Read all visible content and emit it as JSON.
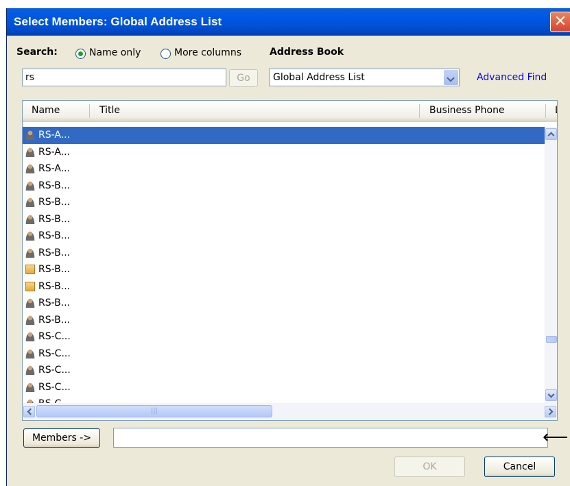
{
  "window": {
    "title": "Select Members: Global Address List",
    "close_glyph": "✕"
  },
  "search": {
    "label": "Search:",
    "options": [
      {
        "label": "Name only",
        "selected": true
      },
      {
        "label": "More columns",
        "selected": false
      }
    ],
    "value": "rs",
    "go_label": "Go"
  },
  "address_book": {
    "label": "Address Book",
    "selected": "Global Address List",
    "advanced_find": "Advanced Find"
  },
  "columns": [
    "Name",
    "Title",
    "Business Phone",
    "L"
  ],
  "rows": [
    {
      "name": "RS-A...",
      "icon": "person-icon",
      "selected": true
    },
    {
      "name": "RS-A...",
      "icon": "person-icon"
    },
    {
      "name": "RS-A...",
      "icon": "person-icon"
    },
    {
      "name": "RS-B...",
      "icon": "person-icon"
    },
    {
      "name": "RS-B...",
      "icon": "person-icon"
    },
    {
      "name": "RS-B...",
      "icon": "person-icon"
    },
    {
      "name": "RS-B...",
      "icon": "person-icon"
    },
    {
      "name": "RS-B...",
      "icon": "person-icon"
    },
    {
      "name": "RS-B...",
      "icon": "distribution-list-icon"
    },
    {
      "name": "RS-B...",
      "icon": "distribution-list-icon"
    },
    {
      "name": "RS-B...",
      "icon": "person-icon"
    },
    {
      "name": "RS-B...",
      "icon": "person-icon"
    },
    {
      "name": "RS-C...",
      "icon": "person-icon"
    },
    {
      "name": "RS-C...",
      "icon": "person-icon"
    },
    {
      "name": "RS-C...",
      "icon": "person-icon"
    },
    {
      "name": "RS-C...",
      "icon": "person-icon"
    },
    {
      "name": "RS-C...",
      "icon": "person-icon"
    }
  ],
  "members": {
    "button_label": "Members ->",
    "value": ""
  },
  "footer": {
    "ok_label": "OK",
    "cancel_label": "Cancel"
  },
  "annotation": {
    "arrow_glyph": "⟵"
  },
  "colors": {
    "title_bar": "#0054e3",
    "selection": "#316ac5",
    "link": "#0000ff"
  }
}
